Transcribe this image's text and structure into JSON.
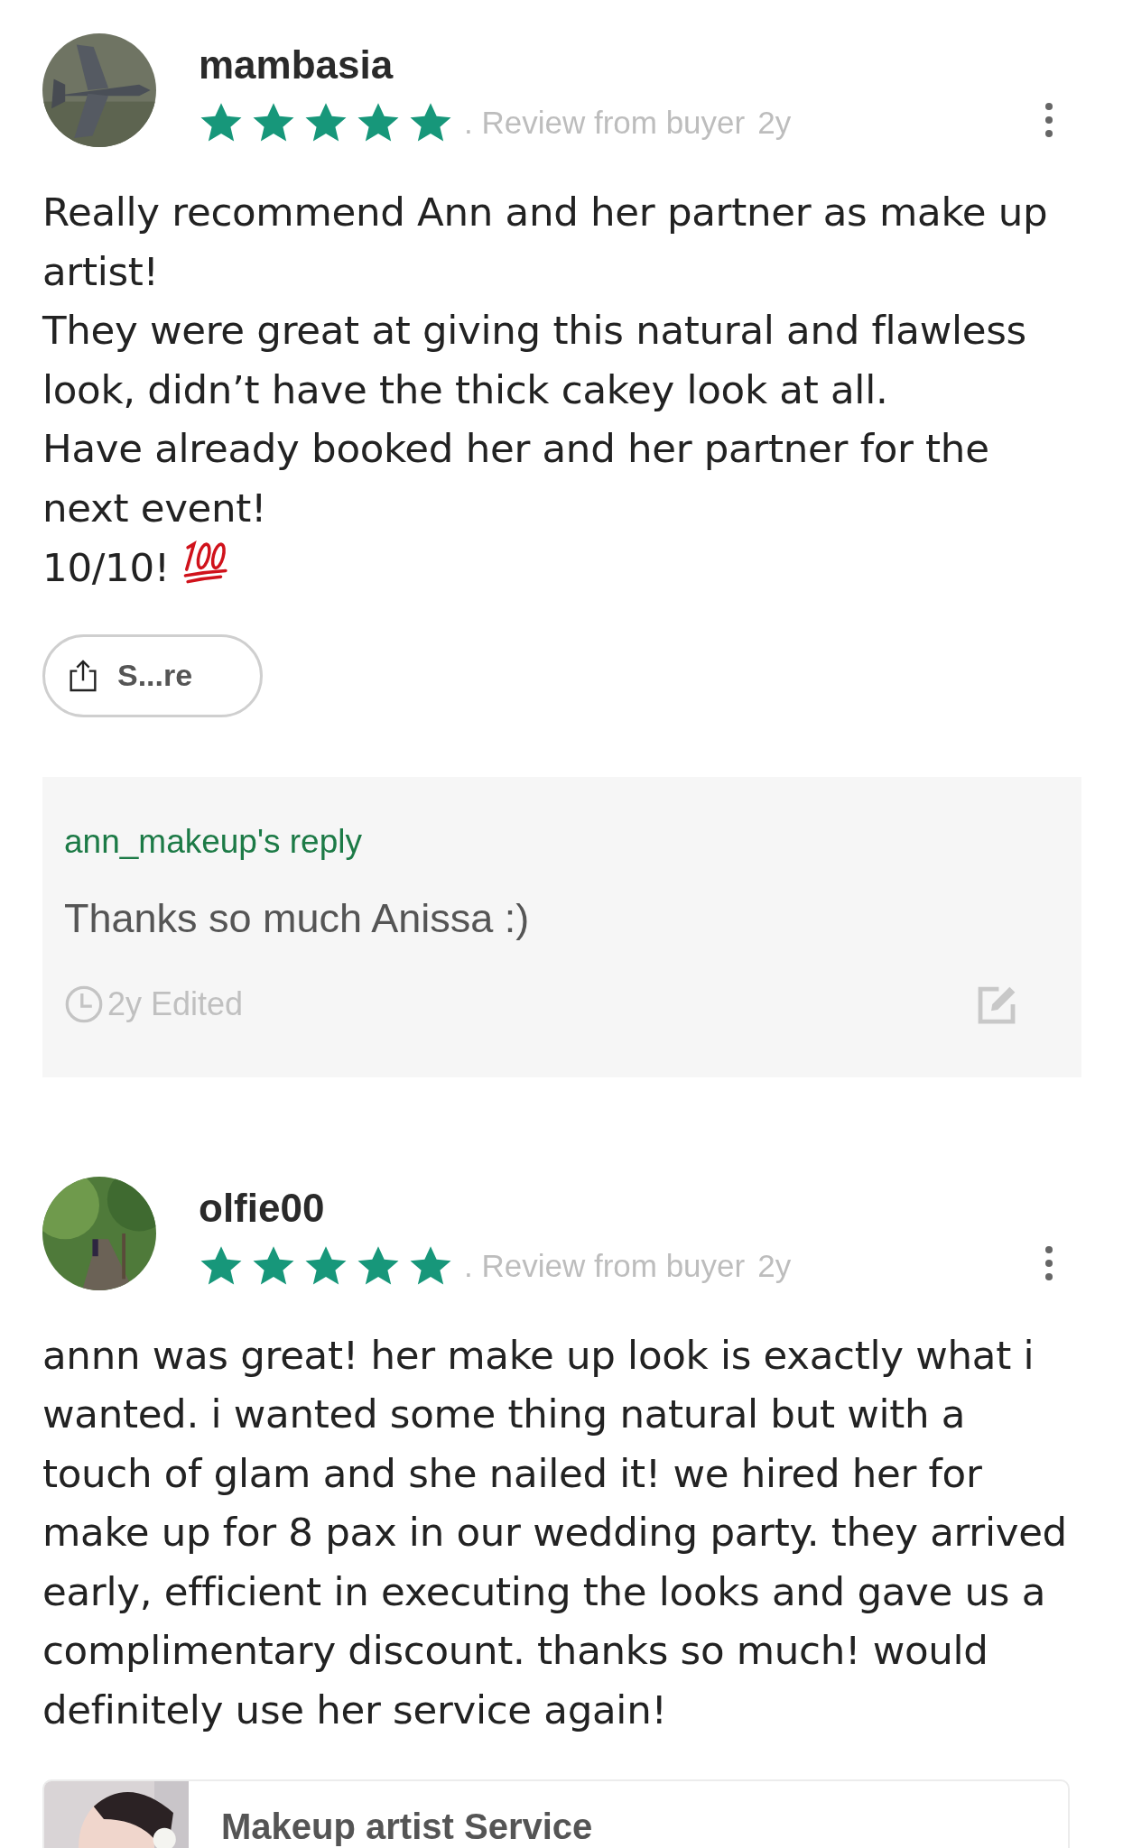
{
  "reviews": [
    {
      "username": "mambasia",
      "stars": 5,
      "source": ". Review from buyer",
      "age": "2y",
      "body": "Really recommend Ann and her partner as make up artist!\nThey were great at giving this natural and flawless look, didn’t have the thick cakey look at all.\nHave already booked her and her partner for the next event!\n10/10!",
      "score_icon": true,
      "share_label": "S...re",
      "reply": {
        "title": "ann_makeup's reply",
        "text": "Thanks so much Anissa :)",
        "footer": "2y Edited"
      }
    },
    {
      "username": "olfie00",
      "stars": 5,
      "source": ". Review from buyer",
      "age": "2y",
      "body": "annn was great! her make up look is exactly what i wanted. i wanted some thing natural but with a touch of glam and she nailed it! we hired her for make up  for 8 pax in our wedding party. they arrived early, efficient in executing the looks and gave us a complimentary discount. thanks so much! would definitely use her service again!",
      "score_icon": false,
      "product": {
        "title": "Makeup artist Service"
      }
    }
  ]
}
